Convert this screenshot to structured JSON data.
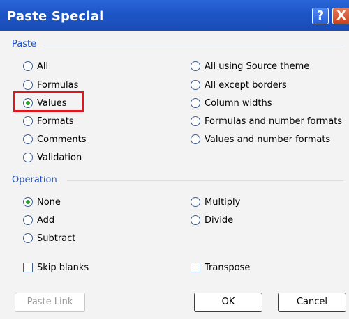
{
  "window": {
    "title": "Paste Special",
    "help_glyph": "?",
    "close_glyph": "X"
  },
  "paste": {
    "label": "Paste",
    "left": [
      {
        "label": "All",
        "checked": false
      },
      {
        "label": "Formulas",
        "checked": false
      },
      {
        "label": "Values",
        "checked": true
      },
      {
        "label": "Formats",
        "checked": false
      },
      {
        "label": "Comments",
        "checked": false
      },
      {
        "label": "Validation",
        "checked": false
      }
    ],
    "right": [
      {
        "label": "All using Source theme",
        "checked": false
      },
      {
        "label": "All except borders",
        "checked": false
      },
      {
        "label": "Column widths",
        "checked": false
      },
      {
        "label": "Formulas and number formats",
        "checked": false
      },
      {
        "label": "Values and number formats",
        "checked": false
      }
    ]
  },
  "operation": {
    "label": "Operation",
    "left": [
      {
        "label": "None",
        "checked": true
      },
      {
        "label": "Add",
        "checked": false
      },
      {
        "label": "Subtract",
        "checked": false
      }
    ],
    "right": [
      {
        "label": "Multiply",
        "checked": false
      },
      {
        "label": "Divide",
        "checked": false
      }
    ]
  },
  "options": {
    "skip_blanks": "Skip blanks",
    "transpose": "Transpose"
  },
  "buttons": {
    "paste_link": "Paste Link",
    "ok": "OK",
    "cancel": "Cancel"
  },
  "colors": {
    "highlight": "#e0151d",
    "section_label": "#1e54c8",
    "titlebar": "#1d55c6"
  },
  "icons": {
    "help": "help-icon",
    "close": "close-icon",
    "radio": "radio-icon",
    "checkbox": "checkbox-icon"
  }
}
